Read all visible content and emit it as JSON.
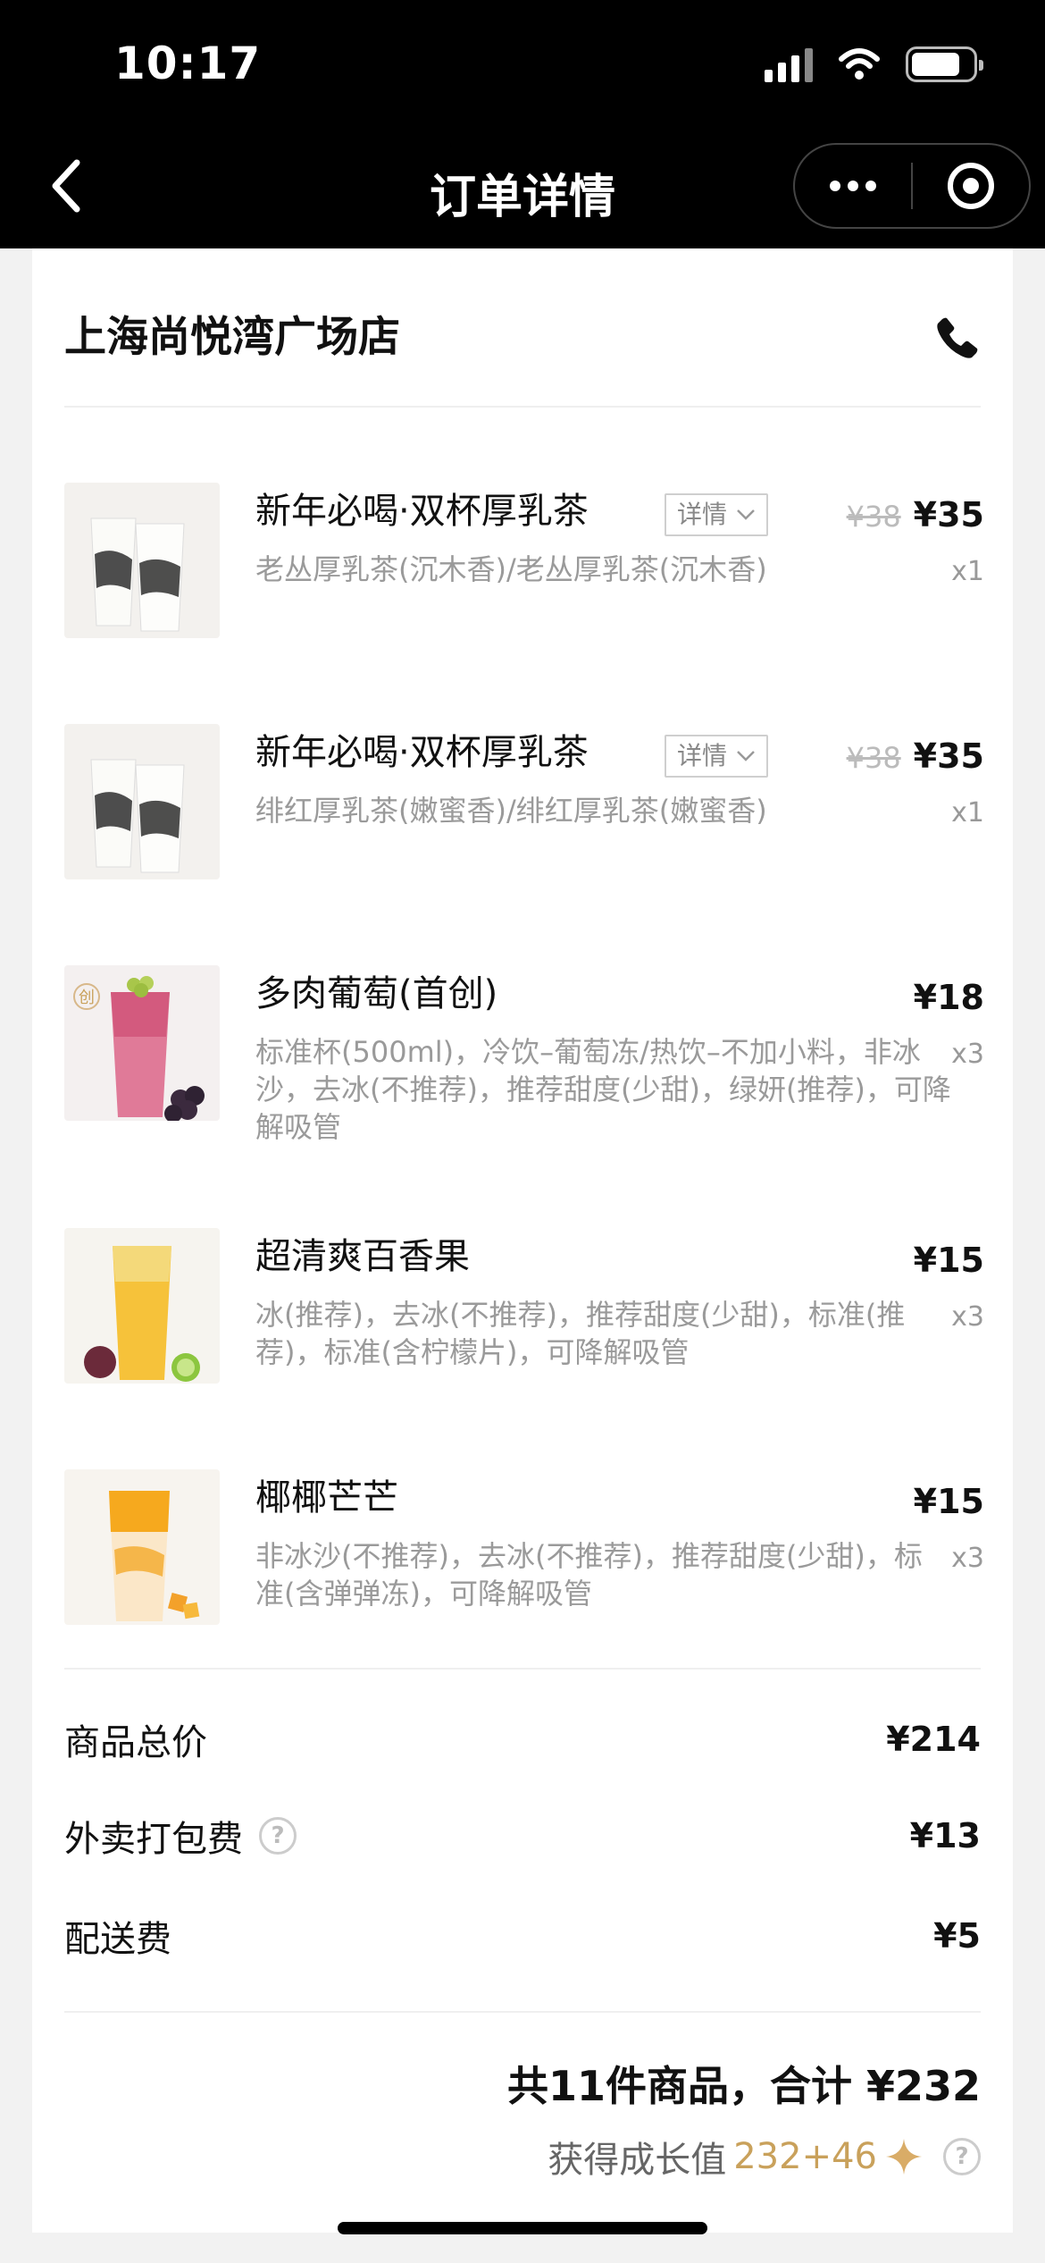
{
  "status": {
    "time": "10:17"
  },
  "nav": {
    "title": "订单详情"
  },
  "store": {
    "name": "上海尚悦湾广场店"
  },
  "items": [
    {
      "name": "新年必喝·双杯厚乳茶",
      "detail_label": "详情",
      "spec": "老丛厚乳茶(沉木香)/老丛厚乳茶(沉木香)",
      "orig_price": "¥38",
      "price": "¥35",
      "qty": "x1"
    },
    {
      "name": "新年必喝·双杯厚乳茶",
      "detail_label": "详情",
      "spec": "绯红厚乳茶(嫩蜜香)/绯红厚乳茶(嫩蜜香)",
      "orig_price": "¥38",
      "price": "¥35",
      "qty": "x1"
    },
    {
      "name": "多肉葡萄(首创)",
      "spec": "标准杯(500ml)，冷饮–葡萄冻/热饮–不加小料，非冰沙，去冰(不推荐)，推荐甜度(少甜)，绿妍(推荐)，可降解吸管",
      "price": "¥18",
      "qty": "x3",
      "badge": "创"
    },
    {
      "name": "超清爽百香果",
      "spec": "冰(推荐)，去冰(不推荐)，推荐甜度(少甜)，标准(推荐)，标准(含柠檬片)，可降解吸管",
      "price": "¥15",
      "qty": "x3"
    },
    {
      "name": "椰椰芒芒",
      "spec": "非冰沙(不推荐)，去冰(不推荐)，推荐甜度(少甜)，标准(含弹弹冻)，可降解吸管",
      "price": "¥15",
      "qty": "x3"
    }
  ],
  "summary": {
    "goods_total_label": "商品总价",
    "goods_total": "¥214",
    "packing_label": "外卖打包费",
    "packing_fee": "¥13",
    "delivery_label": "配送费",
    "delivery_fee": "¥5"
  },
  "total": {
    "text": "共11件商品，合计 ¥232"
  },
  "growth": {
    "label": "获得成长值",
    "value": "232+46"
  },
  "colors": {
    "accent_gold": "#c9a15b"
  }
}
